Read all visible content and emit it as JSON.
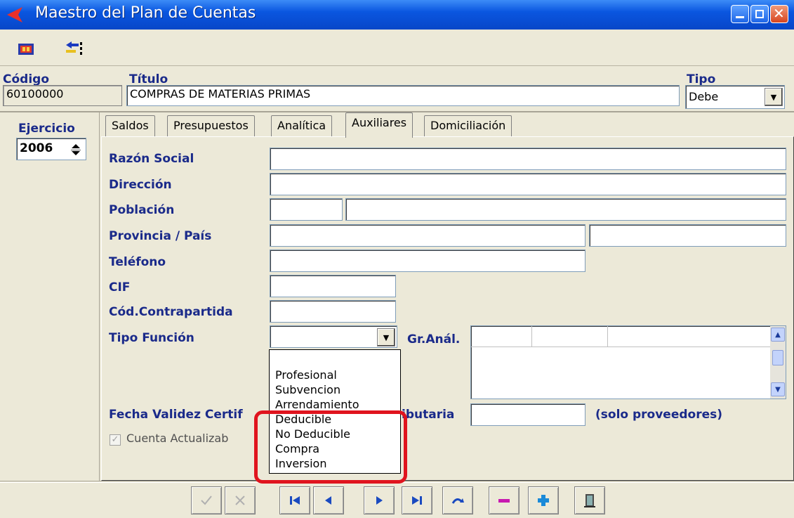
{
  "window": {
    "title": "Maestro del Plan de Cuentas"
  },
  "header": {
    "codigo_label": "Código",
    "codigo_value": "60100000",
    "titulo_label": "Título",
    "titulo_value": "COMPRAS DE MATERIAS PRIMAS",
    "tipo_label": "Tipo",
    "tipo_value": "Debe"
  },
  "ejercicio": {
    "label": "Ejercicio",
    "value": "2006"
  },
  "tabs": [
    {
      "label": "Saldos"
    },
    {
      "label": "Presupuestos"
    },
    {
      "label": "Analítica"
    },
    {
      "label": "Auxiliares"
    },
    {
      "label": "Domiciliación"
    }
  ],
  "active_tab": "Auxiliares",
  "form": {
    "razon_social": "Razón Social",
    "direccion": "Dirección",
    "poblacion": "Población",
    "provincia": "Provincia / País",
    "telefono": "Teléfono",
    "cif": "CIF",
    "cod_contrapartida": "Cód.Contrapartida",
    "tipo_funcion": "Tipo Función",
    "gr_anal": "Gr.Anál.",
    "fecha_validez_left": "Fecha Validez Certif",
    "fecha_validez_right": "ibutaria",
    "solo_proveedores": "(solo proveedores)",
    "cuenta_actualizable": "Cuenta Actualizab"
  },
  "dropdown_options": [
    "Profesional",
    "Subvencion",
    "Arrendamiento",
    "Deducible",
    "No Deducible",
    "Compra",
    "Inversion"
  ],
  "highlight_color": "#e0141e"
}
